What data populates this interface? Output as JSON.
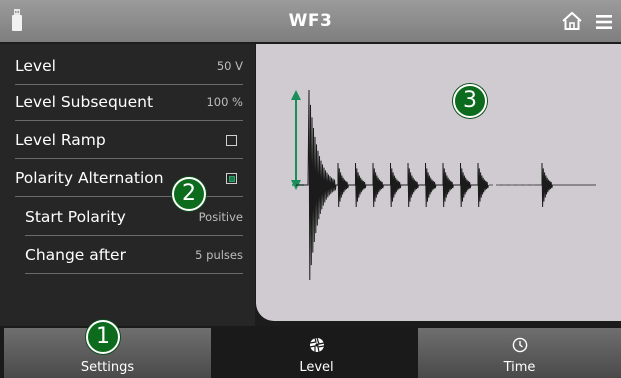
{
  "header": {
    "title": "WF3"
  },
  "settings": {
    "rows": [
      {
        "label": "Level",
        "value": "50 V"
      },
      {
        "label": "Level Subsequent",
        "value": "100 %"
      },
      {
        "label": "Level Ramp",
        "checked": false
      },
      {
        "label": "Polarity Alternation",
        "checked": true
      },
      {
        "label": "Start Polarity",
        "value": "Positive"
      },
      {
        "label": "Change after",
        "value": "5 pulses"
      }
    ]
  },
  "badges": {
    "one": "1",
    "two": "2",
    "three": "3"
  },
  "tabs": [
    {
      "label": "Settings",
      "icon": "none"
    },
    {
      "label": "Level",
      "icon": "aperture-icon"
    },
    {
      "label": "Time",
      "icon": "clock-icon"
    }
  ],
  "colors": {
    "accent_green": "#0d6b1e",
    "arrow_green": "#1a8f5c",
    "plot_bg": "#cfcbd0"
  }
}
